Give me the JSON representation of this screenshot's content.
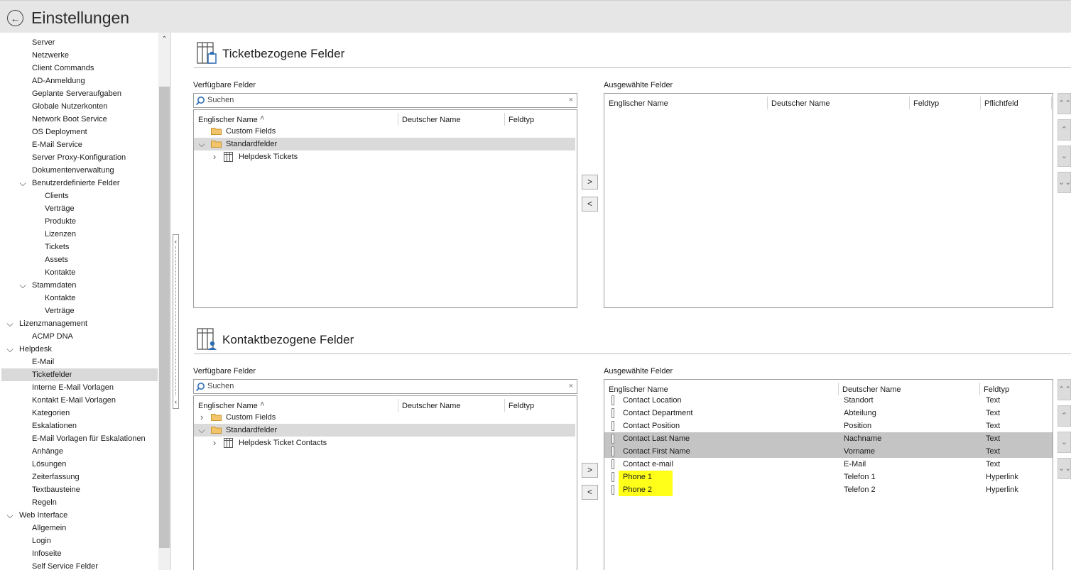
{
  "window": {
    "title": "Einstellungen"
  },
  "sidebar": {
    "items": [
      {
        "label": "Server",
        "level": 2,
        "caret": "",
        "selected": false
      },
      {
        "label": "Netzwerke",
        "level": 2,
        "caret": "",
        "selected": false
      },
      {
        "label": "Client Commands",
        "level": 2,
        "caret": "",
        "selected": false
      },
      {
        "label": "AD-Anmeldung",
        "level": 2,
        "caret": "",
        "selected": false
      },
      {
        "label": "Geplante Serveraufgaben",
        "level": 2,
        "caret": "",
        "selected": false
      },
      {
        "label": "Globale Nutzerkonten",
        "level": 2,
        "caret": "",
        "selected": false
      },
      {
        "label": "Network Boot Service",
        "level": 2,
        "caret": "",
        "selected": false
      },
      {
        "label": "OS Deployment",
        "level": 2,
        "caret": "",
        "selected": false
      },
      {
        "label": "E-Mail Service",
        "level": 2,
        "caret": "",
        "selected": false
      },
      {
        "label": "Server Proxy-Konfiguration",
        "level": 2,
        "caret": "",
        "selected": false
      },
      {
        "label": "Dokumentenverwaltung",
        "level": 2,
        "caret": "",
        "selected": false
      },
      {
        "label": "Benutzerdefinierte Felder",
        "level": 2,
        "caret": "expanded",
        "selected": false
      },
      {
        "label": "Clients",
        "level": 3,
        "caret": "",
        "selected": false
      },
      {
        "label": "Verträge",
        "level": 3,
        "caret": "",
        "selected": false
      },
      {
        "label": "Produkte",
        "level": 3,
        "caret": "",
        "selected": false
      },
      {
        "label": "Lizenzen",
        "level": 3,
        "caret": "",
        "selected": false
      },
      {
        "label": "Tickets",
        "level": 3,
        "caret": "",
        "selected": false
      },
      {
        "label": "Assets",
        "level": 3,
        "caret": "",
        "selected": false
      },
      {
        "label": "Kontakte",
        "level": 3,
        "caret": "",
        "selected": false
      },
      {
        "label": "Stammdaten",
        "level": 2,
        "caret": "expanded",
        "selected": false
      },
      {
        "label": "Kontakte",
        "level": 3,
        "caret": "",
        "selected": false
      },
      {
        "label": "Verträge",
        "level": 3,
        "caret": "",
        "selected": false
      },
      {
        "label": "Lizenzmanagement",
        "level": 1,
        "caret": "expanded",
        "selected": false
      },
      {
        "label": "ACMP DNA",
        "level": 2,
        "caret": "",
        "selected": false
      },
      {
        "label": "Helpdesk",
        "level": 1,
        "caret": "expanded",
        "selected": false
      },
      {
        "label": "E-Mail",
        "level": 2,
        "caret": "",
        "selected": false
      },
      {
        "label": "Ticketfelder",
        "level": 2,
        "caret": "",
        "selected": true
      },
      {
        "label": "Interne E-Mail Vorlagen",
        "level": 2,
        "caret": "",
        "selected": false
      },
      {
        "label": "Kontakt E-Mail Vorlagen",
        "level": 2,
        "caret": "",
        "selected": false
      },
      {
        "label": "Kategorien",
        "level": 2,
        "caret": "",
        "selected": false
      },
      {
        "label": "Eskalationen",
        "level": 2,
        "caret": "",
        "selected": false
      },
      {
        "label": "E-Mail Vorlagen für Eskalationen",
        "level": 2,
        "caret": "",
        "selected": false
      },
      {
        "label": "Anhänge",
        "level": 2,
        "caret": "",
        "selected": false
      },
      {
        "label": "Lösungen",
        "level": 2,
        "caret": "",
        "selected": false
      },
      {
        "label": "Zeiterfassung",
        "level": 2,
        "caret": "",
        "selected": false
      },
      {
        "label": "Textbausteine",
        "level": 2,
        "caret": "",
        "selected": false
      },
      {
        "label": "Regeln",
        "level": 2,
        "caret": "",
        "selected": false
      },
      {
        "label": "Web Interface",
        "level": 1,
        "caret": "expanded",
        "selected": false
      },
      {
        "label": "Allgemein",
        "level": 2,
        "caret": "",
        "selected": false
      },
      {
        "label": "Login",
        "level": 2,
        "caret": "",
        "selected": false
      },
      {
        "label": "Infoseite",
        "level": 2,
        "caret": "",
        "selected": false
      },
      {
        "label": "Self Service Felder",
        "level": 2,
        "caret": "",
        "selected": false
      }
    ]
  },
  "sections": [
    {
      "title": "Ticketbezogene Felder",
      "icon": "ticket-table-icon",
      "available": {
        "label": "Verfügbare Felder",
        "search_placeholder": "Suchen",
        "columns": [
          "Englischer Name",
          "Deutscher Name",
          "Feldtyp"
        ],
        "rows": [
          {
            "name": "Custom Fields",
            "kind": "folder",
            "caret": "",
            "indent": 1
          },
          {
            "name": "Standardfelder",
            "kind": "folder",
            "caret": "expanded",
            "indent": 0,
            "highlight": true
          },
          {
            "name": "Helpdesk Tickets",
            "kind": "table",
            "caret": "collapsed",
            "indent": 2
          }
        ]
      },
      "selected": {
        "label": "Ausgewählte Felder",
        "columns": [
          "Englischer Name",
          "Deutscher Name",
          "Feldtyp",
          "Pflichtfeld"
        ],
        "rows": []
      }
    },
    {
      "title": "Kontaktbezogene Felder",
      "icon": "contact-table-icon",
      "available": {
        "label": "Verfügbare Felder",
        "search_placeholder": "Suchen",
        "columns": [
          "Englischer Name",
          "Deutscher Name",
          "Feldtyp"
        ],
        "rows": [
          {
            "name": "Custom Fields",
            "kind": "folder",
            "caret": "collapsed",
            "indent": 1
          },
          {
            "name": "Standardfelder",
            "kind": "folder",
            "caret": "expanded",
            "indent": 0,
            "highlight": true
          },
          {
            "name": "Helpdesk Ticket Contacts",
            "kind": "table",
            "caret": "collapsed",
            "indent": 2
          }
        ]
      },
      "selected": {
        "label": "Ausgewählte Felder",
        "columns": [
          "Englischer Name",
          "Deutscher Name",
          "Feldtyp"
        ],
        "rows": [
          {
            "en": "Contact Location",
            "de": "Standort",
            "type": "Text",
            "selected": false,
            "marked": false
          },
          {
            "en": "Contact Department",
            "de": "Abteilung",
            "type": "Text",
            "selected": false,
            "marked": false
          },
          {
            "en": "Contact Position",
            "de": "Position",
            "type": "Text",
            "selected": false,
            "marked": false
          },
          {
            "en": "Contact Last Name",
            "de": "Nachname",
            "type": "Text",
            "selected": true,
            "marked": false
          },
          {
            "en": "Contact First Name",
            "de": "Vorname",
            "type": "Text",
            "selected": true,
            "marked": false
          },
          {
            "en": "Contact e-mail",
            "de": "E-Mail",
            "type": "Text",
            "selected": false,
            "marked": false
          },
          {
            "en": "Phone 1",
            "de": "Telefon 1",
            "type": "Hyperlink",
            "selected": false,
            "marked": true
          },
          {
            "en": "Phone 2",
            "de": "Telefon 2",
            "type": "Hyperlink",
            "selected": false,
            "marked": true
          }
        ]
      }
    }
  ],
  "buttons": {
    "add": ">",
    "remove": "<"
  },
  "colors": {
    "highlighter": "#ffff1a",
    "selection": "#c4c4c4",
    "titlebar": "#e6e6e6"
  }
}
